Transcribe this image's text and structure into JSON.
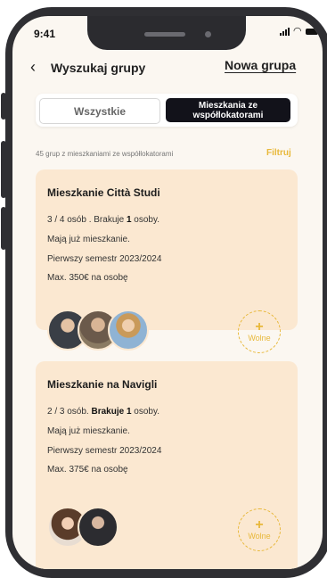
{
  "status_bar": {
    "time": "9:41"
  },
  "header": {
    "back_icon": "chevron-left-icon",
    "title": "Wyszukaj grupy",
    "new_group": "Nowa grupa"
  },
  "segment": {
    "all": "Wszystkie",
    "roommates": "Mieszkania ze współlokatorami",
    "selected": "roommates"
  },
  "results": {
    "count_text": "45 grup z mieszkaniami ze współlokatorami",
    "filter": "Filtruj"
  },
  "cards": [
    {
      "title": "Mieszkanie Città Studi",
      "line1_pre": "3 / 4 osób . Brakuje ",
      "line1_bold": "1",
      "line1_post": " osoby.",
      "line2": "Mają już mieszkanie.",
      "line3": "Pierwszy semestr 2023/2024",
      "line4": "Max. 350€ na osobę",
      "free_label": "Wolne",
      "members": 3
    },
    {
      "title": "Mieszkanie na Navigli",
      "line1_pre": "2 / 3 osób. ",
      "line1_bold": "Brakuje 1",
      "line1_post": " osoby.",
      "line2": "Mają już mieszkanie.",
      "line3": "Pierwszy semestr 2023/2024",
      "line4": "Max. 375€ na osobę",
      "free_label": "Wolne",
      "members": 2
    }
  ],
  "colors": {
    "accent": "#e8b83a",
    "card_bg": "#fbe8d1",
    "selected_segment": "#12121a"
  }
}
